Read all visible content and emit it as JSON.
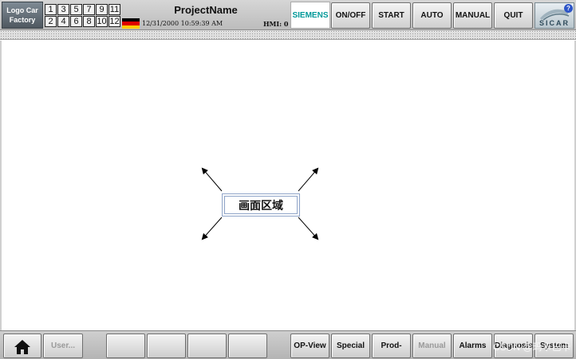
{
  "header": {
    "logo_line1": "Logo Car",
    "logo_line2": "Factory",
    "screen_numbers": [
      "1",
      "3",
      "5",
      "7",
      "9",
      "11",
      "2",
      "4",
      "6",
      "8",
      "10",
      "12"
    ],
    "project_name": "ProjectName",
    "datetime": "12/31/2000 10:59:39 AM",
    "hmi_status": "HMI: 0",
    "brand": "SIEMENS",
    "buttons": [
      "ON/OFF",
      "START",
      "AUTO",
      "MANUAL",
      "QUIT"
    ],
    "product_logo": "SICAR",
    "help_glyph": "?",
    "flag_colors": [
      "#000000",
      "#dd0000",
      "#ffcc00"
    ]
  },
  "main": {
    "area_label": "画面区域"
  },
  "footer": {
    "home_icon": "home-icon",
    "user_label": "User...",
    "empty_slots": [
      "",
      "",
      "",
      ""
    ],
    "buttons": [
      {
        "label": "OP-View",
        "enabled": true
      },
      {
        "label": "Special",
        "enabled": true
      },
      {
        "label": "Prod-Data",
        "enabled": true
      },
      {
        "label": "Manual",
        "enabled": false
      },
      {
        "label": "Alarms",
        "enabled": true
      },
      {
        "label": "Diagnosis",
        "enabled": true
      },
      {
        "label": "System",
        "enabled": true
      }
    ]
  },
  "watermark": "CSDN @玛卡巴卡"
}
